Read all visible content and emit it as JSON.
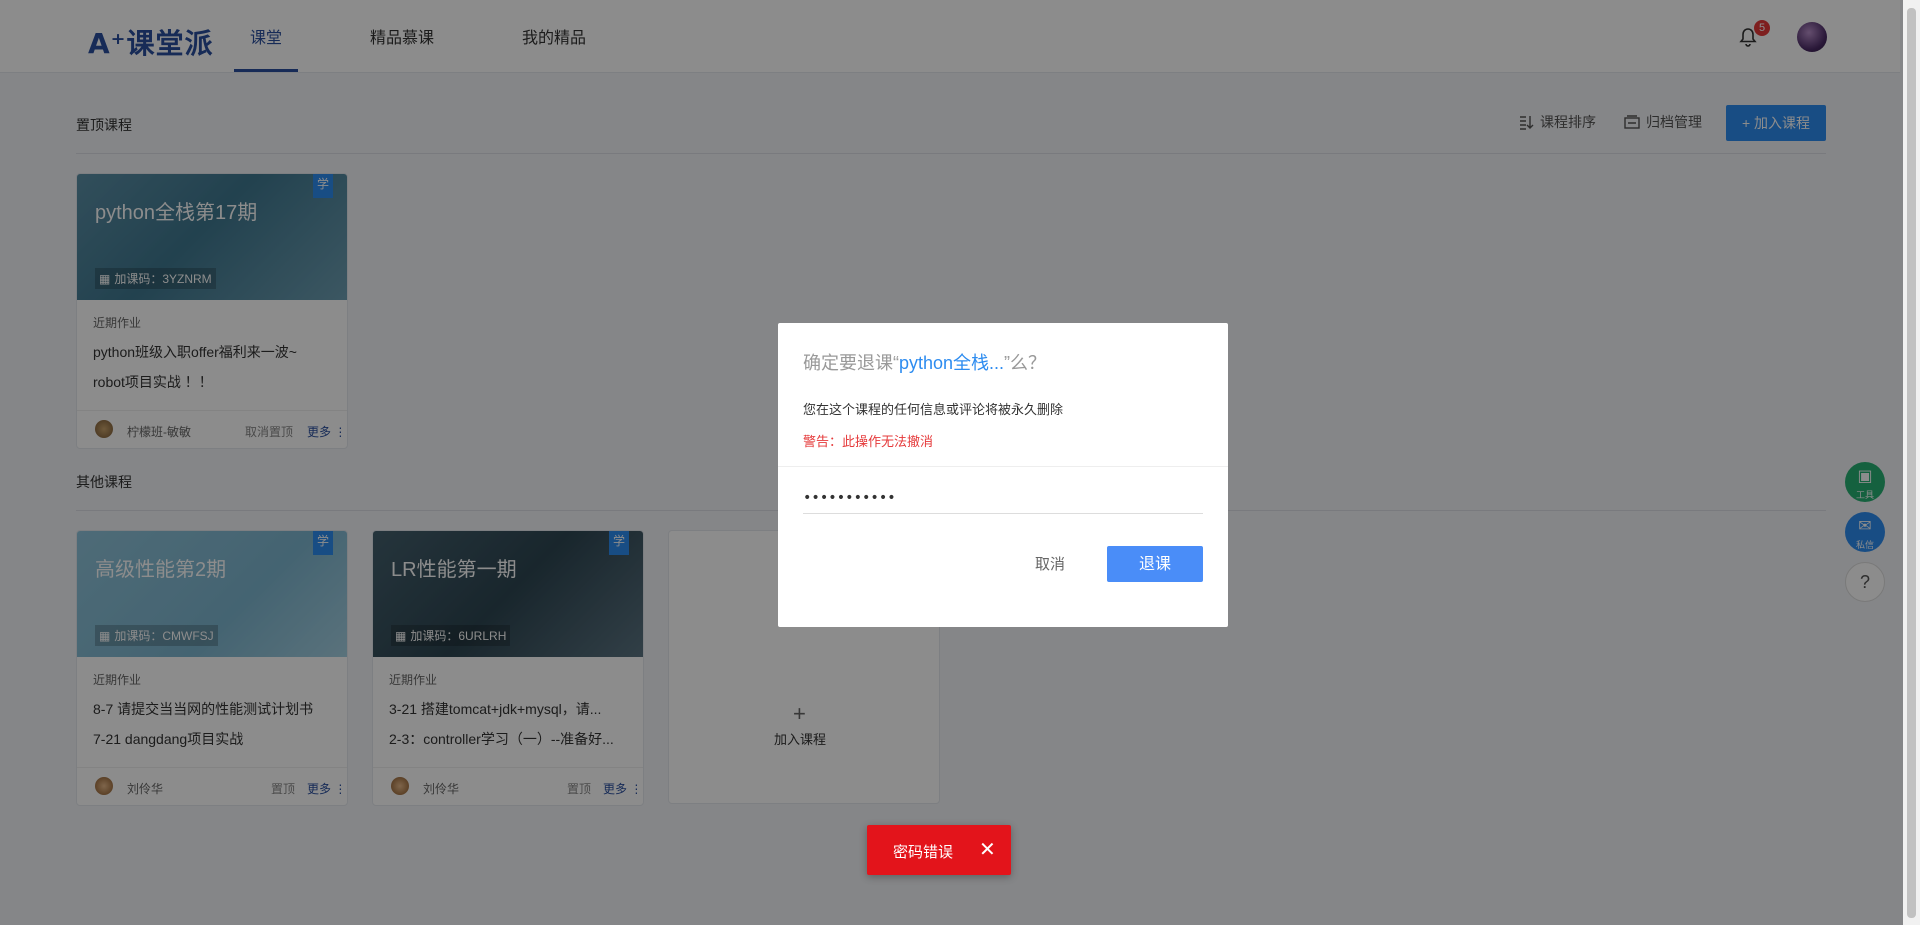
{
  "app": {
    "logo": "A⁺课堂派"
  },
  "nav": {
    "items": [
      "课堂",
      "精品慕课",
      "我的精品"
    ]
  },
  "header": {
    "badge_count": "5"
  },
  "pinned": {
    "title": "置顶课程",
    "sort_label": "课程排序",
    "archive_label": "归档管理",
    "join_label": "+ 加入课程"
  },
  "others": {
    "title": "其他课程"
  },
  "cards": [
    {
      "title": "python全栈第17期",
      "code": "加课码：3YZNRM",
      "tag": "学",
      "hw_label": "近期作业",
      "hw1": "python班级入职offer福利来一波~",
      "hw2": "robot项目实战 ！！",
      "teacher": "柠檬班-敏敏",
      "action": "取消置顶",
      "more": "更多 ⋮"
    },
    {
      "title": "高级性能第2期",
      "code": "加课码：CMWFSJ",
      "tag": "学",
      "hw_label": "近期作业",
      "hw1": "8-7 请提交当当网的性能测试计划书",
      "hw2": "7-21 dangdang项目实战",
      "teacher": "刘伶华",
      "action": "置顶",
      "more": "更多 ⋮"
    },
    {
      "title": "LR性能第一期",
      "code": "加课码：6URLRH",
      "tag": "学",
      "hw_label": "近期作业",
      "hw1": "3-21 搭建tomcat+jdk+mysql，请...",
      "hw2": "2-3：controller学习（一）--准备好...",
      "teacher": "刘伶华",
      "action": "置顶",
      "more": "更多 ⋮"
    }
  ],
  "add_card": {
    "plus": "+",
    "label": "加入课程"
  },
  "side": {
    "tools_label": "工具",
    "msg_label": "私信",
    "help": "?"
  },
  "modal": {
    "title_prefix": "确定要退课“",
    "title_course": "python全栈...",
    "title_suffix": "”么？",
    "message": "您在这个课程的任何信息或评论将被永久删除",
    "warning": "警告：此操作无法撤消",
    "password_value": "•••••••••••",
    "cancel": "取消",
    "confirm": "退课"
  },
  "toast": {
    "message": "密码错误",
    "close": "✕"
  },
  "colors": {
    "brand": "#2a4f9e",
    "primary": "#2d8cf0",
    "danger": "#e3141b"
  }
}
